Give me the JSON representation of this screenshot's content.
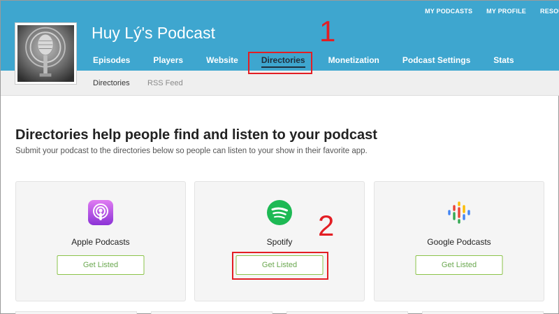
{
  "top_nav": {
    "my_podcasts": "MY PODCASTS",
    "my_profile": "MY PROFILE",
    "resources": "RESOU"
  },
  "podcast": {
    "title": "Huy Lý's Podcast"
  },
  "main_tabs": [
    {
      "label": "Episodes"
    },
    {
      "label": "Players"
    },
    {
      "label": "Website"
    },
    {
      "label": "Directories"
    },
    {
      "label": "Monetization"
    },
    {
      "label": "Podcast Settings"
    },
    {
      "label": "Stats"
    }
  ],
  "sub_tabs": [
    {
      "label": "Directories"
    },
    {
      "label": "RSS Feed"
    }
  ],
  "annotations": {
    "one": "1",
    "two": "2"
  },
  "content": {
    "headline": "Directories help people find and listen to your podcast",
    "subline": "Submit your podcast to the directories below so people can listen to your show in their favorite app."
  },
  "directories": [
    {
      "name": "Apple Podcasts",
      "button": "Get Listed",
      "icon": "apple-podcasts-icon"
    },
    {
      "name": "Spotify",
      "button": "Get Listed",
      "icon": "spotify-icon"
    },
    {
      "name": "Google Podcasts",
      "button": "Get Listed",
      "icon": "google-podcasts-icon"
    }
  ],
  "colors": {
    "header": "#3ea6cf",
    "annotation": "#e31e24",
    "button_border": "#8bc34a",
    "button_text": "#6aa84f",
    "spotify": "#1db954",
    "apple_podcasts": "#a74fe0"
  }
}
